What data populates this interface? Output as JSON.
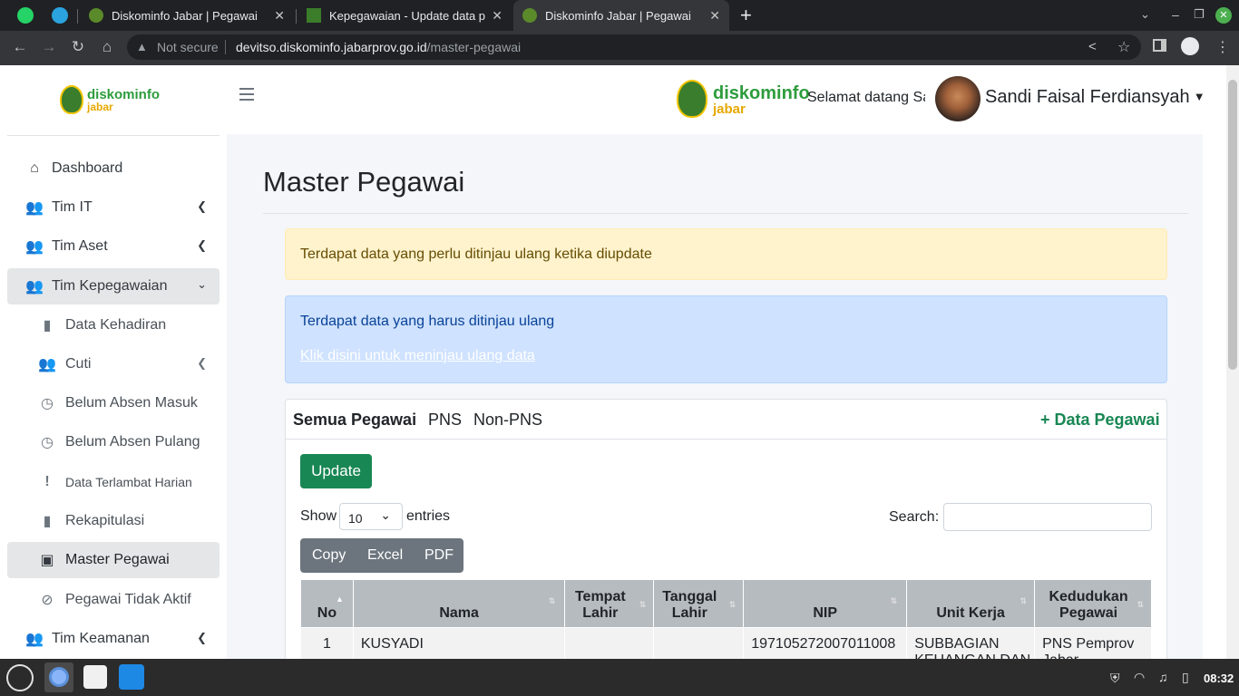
{
  "browser": {
    "tabs": [
      {
        "title": "Diskominfo Jabar | Pegawai"
      },
      {
        "title": "Kepegawaian - Update data p"
      },
      {
        "title": "Diskominfo Jabar | Pegawai"
      }
    ],
    "not_secure": "Not secure",
    "url_domain": "devitso.diskominfo.jabarprov.go.id",
    "url_path": "/master-pegawai"
  },
  "header": {
    "welcome": "Selamat datang Sa",
    "user_name": "Sandi Faisal Ferdiansyah"
  },
  "logo": {
    "word1": "diskominfo",
    "word2": "jabar"
  },
  "sidebar": {
    "items": [
      {
        "label": "Dashboard",
        "icon": "home-icon"
      },
      {
        "label": "Tim IT",
        "icon": "users-icon"
      },
      {
        "label": "Tim Aset",
        "icon": "users-icon"
      },
      {
        "label": "Tim Kepegawaian",
        "icon": "users-icon"
      },
      {
        "label": "Data Kehadiran",
        "icon": "file-icon"
      },
      {
        "label": "Cuti",
        "icon": "users-icon"
      },
      {
        "label": "Belum Absen Masuk",
        "icon": "clock-icon"
      },
      {
        "label": "Belum Absen Pulang",
        "icon": "clock-icon"
      },
      {
        "label": "Data Terlambat Harian",
        "icon": "exclamation-icon"
      },
      {
        "label": "Rekapitulasi",
        "icon": "file-icon"
      },
      {
        "label": "Master Pegawai",
        "icon": "address-book-icon"
      },
      {
        "label": "Pegawai Tidak Aktif",
        "icon": "user-slash-icon"
      },
      {
        "label": "Tim Keamanan",
        "icon": "users-icon"
      }
    ]
  },
  "main": {
    "title": "Master Pegawai",
    "alert_warning": "Terdapat data yang perlu ditinjau ulang ketika diupdate",
    "alert_info": "Terdapat data yang harus ditinjau ulang",
    "alert_link": "Klik disini untuk meninjau ulang data",
    "tabs": [
      "Semua Pegawai",
      "PNS",
      "Non-PNS"
    ],
    "add_button": "+ Data Pegawai",
    "update_button": "Update",
    "show_label": "Show",
    "entries_value": "10",
    "entries_label": "entries",
    "search_label": "Search:",
    "export_buttons": [
      "Copy",
      "Excel",
      "PDF"
    ],
    "table": {
      "columns": [
        "No",
        "Nama",
        "Tempat Lahir",
        "Tanggal Lahir",
        "NIP",
        "Unit Kerja",
        "Kedudukan Pegawai"
      ],
      "rows": [
        {
          "no": "1",
          "nama": "KUSYADI",
          "tempat": "",
          "tanggal": "",
          "nip": "197105272007011008",
          "unit": "SUBBAGIAN KEUANGAN DAN",
          "kedudukan": "PNS Pemprov Jabar"
        }
      ]
    }
  },
  "taskbar": {
    "time": "08:32"
  },
  "colors": {
    "green": "#198754",
    "warning_bg": "#fff3cd",
    "info_bg": "#cfe2ff",
    "th_bg": "#b6bbc0"
  }
}
